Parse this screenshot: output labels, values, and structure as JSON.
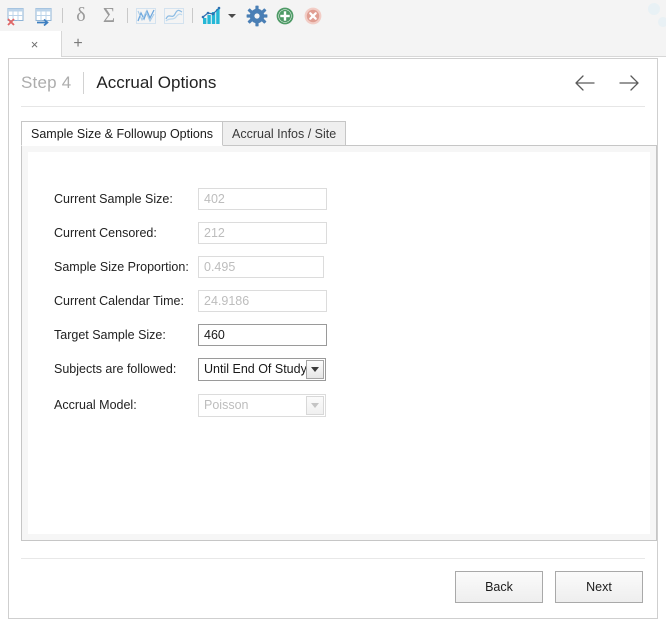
{
  "toolbar": {
    "items": [
      {
        "name": "table-delete-icon",
        "label": "Delete Table"
      },
      {
        "name": "table-export-icon",
        "label": "Export Table"
      },
      {
        "name": "separator-1",
        "label": "|"
      },
      {
        "name": "delta-icon",
        "label": "δ"
      },
      {
        "name": "sigma-icon",
        "label": "Σ"
      },
      {
        "name": "separator-2",
        "label": "|"
      },
      {
        "name": "line-chart-icon",
        "label": "Line Chart"
      },
      {
        "name": "smooth-curve-chart-icon",
        "label": "Smooth Curve Chart"
      },
      {
        "name": "separator-3",
        "label": "|"
      },
      {
        "name": "bar-chart-icon",
        "label": "Bar Chart"
      },
      {
        "name": "chart-dropdown-caret-icon",
        "label": "More Charts"
      },
      {
        "name": "settings-gear-icon",
        "label": "Settings"
      },
      {
        "name": "add-plus-icon",
        "label": "Add"
      },
      {
        "name": "close-cross-icon",
        "label": "Close"
      }
    ]
  },
  "tabstrip": {
    "document_tab_close": "×",
    "new_tab": "+"
  },
  "header": {
    "step": "Step 4",
    "divider": "|",
    "title": "Accrual Options",
    "back_arrow": "←",
    "forward_arrow": "→"
  },
  "tabs": [
    {
      "label": "Sample Size & Followup Options",
      "active": true
    },
    {
      "label": "Accrual Infos / Site",
      "active": false
    }
  ],
  "form": {
    "fields": [
      {
        "id": "current-sample-size",
        "label": "Current Sample Size:",
        "type": "text",
        "value": "402",
        "enabled": false
      },
      {
        "id": "current-censored",
        "label": "Current Censored:",
        "type": "text",
        "value": "212",
        "enabled": false
      },
      {
        "id": "sample-size-proportion",
        "label": "Sample Size Proportion:",
        "type": "text",
        "value": "0.495",
        "enabled": false
      },
      {
        "id": "current-calendar-time",
        "label": "Current Calendar Time:",
        "type": "text",
        "value": "24.9186",
        "enabled": false
      },
      {
        "id": "target-sample-size",
        "label": "Target Sample Size:",
        "type": "text",
        "value": "460",
        "enabled": true
      },
      {
        "id": "subjects-are-followed",
        "label": "Subjects are followed:",
        "type": "select",
        "value": "Until End Of Study",
        "enabled": true
      },
      {
        "id": "accrual-model",
        "label": "Accrual Model:",
        "type": "select",
        "value": "Poisson",
        "enabled": false
      }
    ]
  },
  "footer": {
    "back_label": "Back",
    "next_label": "Next"
  },
  "colors": {
    "accent_blue": "#4a87c4",
    "accent_teal": "#29b6d8",
    "accent_green": "#4e9a66",
    "accent_red_soft": "#e8a79d",
    "toolbar_bg": "#f4f4f4",
    "panel_bg": "#f6f6f6",
    "border": "#c6c6c6"
  }
}
